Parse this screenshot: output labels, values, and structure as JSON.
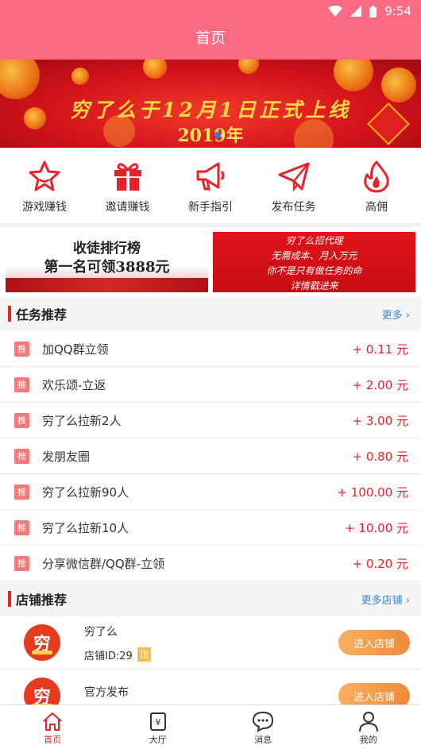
{
  "status_bar": {
    "time": "9:54"
  },
  "header": {
    "title": "首页"
  },
  "banner": {
    "line1": "穷了么于12月1日正式上线",
    "line2": "2019年"
  },
  "icon_nav": [
    {
      "label": "游戏赚钱",
      "icon": "star-icon"
    },
    {
      "label": "邀请赚钱",
      "icon": "gift-icon"
    },
    {
      "label": "新手指引",
      "icon": "megaphone-icon"
    },
    {
      "label": "发布任务",
      "icon": "paper-plane-icon"
    },
    {
      "label": "高佣",
      "icon": "flame-icon"
    }
  ],
  "ads": {
    "left": {
      "line1": "收徒排行榜",
      "line2": "第一名可领3888元"
    },
    "right": {
      "line1": "穷了么招代理",
      "line2": "无需成本、月入万元",
      "line3": "你不是只有做任务的命",
      "line4": "详情戳进来"
    }
  },
  "tasks_section": {
    "title": "任务推荐",
    "more": "更多"
  },
  "tasks": [
    {
      "tag": "推",
      "name": "加QQ群立领",
      "reward": "+ 0.11 元"
    },
    {
      "tag": "推",
      "name": "欢乐颂-立返",
      "reward": "+ 2.00 元"
    },
    {
      "tag": "推",
      "name": "穷了么拉新2人",
      "reward": "+ 3.00 元"
    },
    {
      "tag": "推",
      "name": "发朋友圈",
      "reward": "+ 0.80 元"
    },
    {
      "tag": "推",
      "name": "穷了么拉新90人",
      "reward": "+ 100.00 元"
    },
    {
      "tag": "推",
      "name": "穷了么拉新10人",
      "reward": "+ 10.00 元"
    },
    {
      "tag": "推",
      "name": "分享微信群/QQ群-立领",
      "reward": "+ 0.20 元"
    }
  ],
  "shops_section": {
    "title": "店铺推荐",
    "more": "更多店铺"
  },
  "shops": [
    {
      "logo": "穷",
      "name": "穷了么",
      "id": "店铺ID:29",
      "badge": "顶",
      "button": "进入店铺"
    },
    {
      "logo": "穷",
      "name": "官方发布",
      "id": "",
      "badge": "",
      "button": "进入店铺"
    }
  ],
  "tabbar": [
    {
      "label": "首页",
      "icon": "home-icon",
      "active": true
    },
    {
      "label": "大厅",
      "icon": "yuan-icon",
      "active": false
    },
    {
      "label": "消息",
      "icon": "chat-icon",
      "active": false
    },
    {
      "label": "我的",
      "icon": "user-icon",
      "active": false
    }
  ],
  "colors": {
    "header": "#fd6b83",
    "accent": "#e8222a",
    "link": "#3a87d8"
  }
}
